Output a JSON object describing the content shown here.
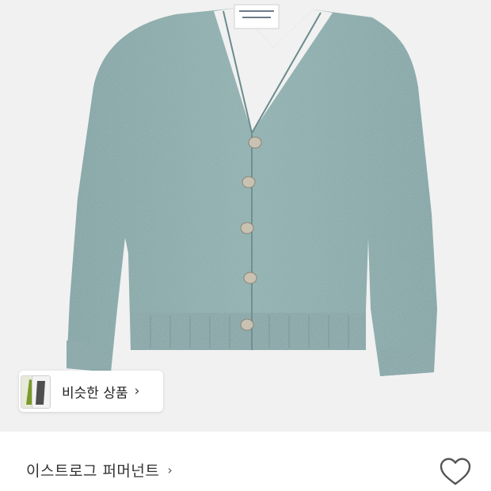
{
  "product": {
    "image_alt": "green cardigan sweater"
  },
  "similar_products": {
    "label": "비슷한 상품",
    "chevron": "›"
  },
  "brand": {
    "name": "이스트로그 퍼머넌트",
    "chevron": "›"
  },
  "like": {
    "icon": "heart-icon"
  },
  "colors": {
    "image_background": "#f1f1f1",
    "sweater": "#86a8a8"
  }
}
